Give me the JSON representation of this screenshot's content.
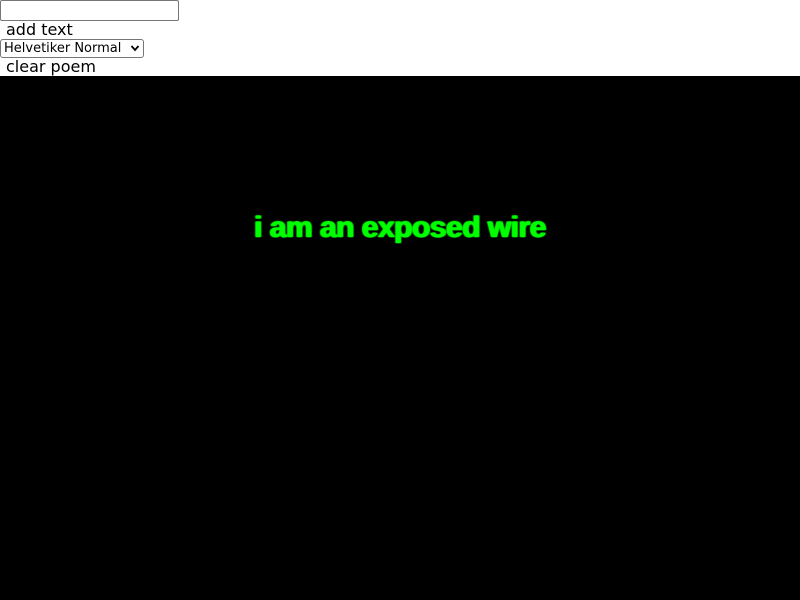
{
  "controls": {
    "text_input": {
      "value": "",
      "placeholder": ""
    },
    "add_text_label": "add text",
    "font_select": {
      "selected": "Helvetiker Normal"
    },
    "clear_label": "clear poem"
  },
  "canvas": {
    "background": "#000000",
    "poem_text": "i am an exposed wire",
    "text_color": "#00ff00"
  }
}
